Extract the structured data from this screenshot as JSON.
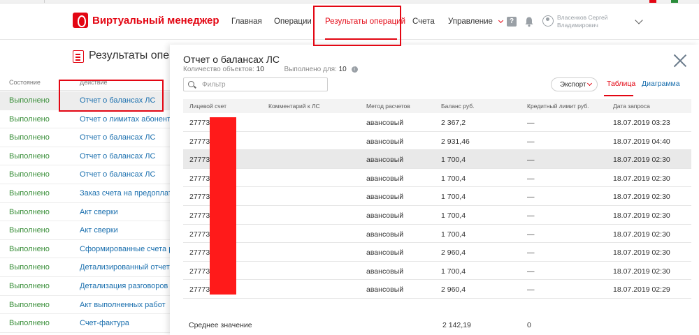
{
  "brand": {
    "name": "Виртуальный менеджер",
    "accent": "#e30613"
  },
  "nav": {
    "items": [
      "Главная",
      "Операции",
      "Результаты операций",
      "Счета",
      "Управление"
    ],
    "active": "Результаты операций",
    "help_label": "?",
    "user_name_line1": "Власенков Сергей",
    "user_name_line2": "Владимирович"
  },
  "left": {
    "title": "Результаты операц",
    "headers": {
      "status": "Состояние",
      "action": "Действие"
    },
    "rows": [
      {
        "status": "Выполнено",
        "action": "Отчет о балансах ЛС"
      },
      {
        "status": "Выполнено",
        "action": "Отчет о лимитах абонентов"
      },
      {
        "status": "Выполнено",
        "action": "Отчет о балансах ЛС"
      },
      {
        "status": "Выполнено",
        "action": "Отчет о балансах ЛС"
      },
      {
        "status": "Выполнено",
        "action": "Отчет о балансах ЛС"
      },
      {
        "status": "Выполнено",
        "action": "Заказ счета на предоплату"
      },
      {
        "status": "Выполнено",
        "action": "Акт сверки"
      },
      {
        "status": "Выполнено",
        "action": "Акт сверки"
      },
      {
        "status": "Выполнено",
        "action": "Сформированные счета расч"
      },
      {
        "status": "Выполнено",
        "action": "Детализированный отчет по"
      },
      {
        "status": "Выполнено",
        "action": "Детализация разговоров"
      },
      {
        "status": "Выполнено",
        "action": "Акт выполненных работ"
      },
      {
        "status": "Выполнено",
        "action": "Счет-фактура"
      }
    ]
  },
  "panel": {
    "title": "Отчет о балансах ЛС",
    "count_label": "Количество объектов:",
    "count_value": "10",
    "done_label": "Выполнено для:",
    "done_value": "10",
    "info_label": "i",
    "filter_placeholder": "Фильтр",
    "export_label": "Экспорт",
    "tabs": [
      "Таблица",
      "Диаграмма"
    ],
    "columns": [
      "Лицевой счет",
      "Комментарий к ЛС",
      "Метод расчетов",
      "Баланс руб.",
      "Кредитный лимит руб.",
      "Дата запроса"
    ],
    "rows": [
      {
        "account": "277738",
        "comment": "",
        "method": "авансовый",
        "balance": "2 367,2",
        "limit": "—",
        "date": "18.07.2019 03:23"
      },
      {
        "account": "277738",
        "comment": "",
        "method": "авансовый",
        "balance": "2 931,46",
        "limit": "—",
        "date": "18.07.2019 04:40"
      },
      {
        "account": "277733",
        "comment": "",
        "method": "авансовый",
        "balance": "1 700,4",
        "limit": "—",
        "date": "18.07.2019 02:30"
      },
      {
        "account": "277733",
        "comment": "",
        "method": "авансовый",
        "balance": "1 700,4",
        "limit": "—",
        "date": "18.07.2019 02:30"
      },
      {
        "account": "277733",
        "comment": "",
        "method": "авансовый",
        "balance": "1 700,4",
        "limit": "—",
        "date": "18.07.2019 02:30"
      },
      {
        "account": "277733",
        "comment": "",
        "method": "авансовый",
        "balance": "1 700,4",
        "limit": "—",
        "date": "18.07.2019 02:30"
      },
      {
        "account": "277733",
        "comment": "",
        "method": "авансовый",
        "balance": "1 700,4",
        "limit": "—",
        "date": "18.07.2019 02:30"
      },
      {
        "account": "277733",
        "comment": "",
        "method": "авансовый",
        "balance": "2 960,4",
        "limit": "—",
        "date": "18.07.2019 02:30"
      },
      {
        "account": "277733",
        "comment": "",
        "method": "авансовый",
        "balance": "1 700,4",
        "limit": "—",
        "date": "18.07.2019 02:30"
      },
      {
        "account": "277733",
        "comment": "",
        "method": "авансовый",
        "balance": "2 960,4",
        "limit": "—",
        "date": "18.07.2019 02:29"
      }
    ],
    "summary": {
      "label": "Среднее значение",
      "balance": "2 142,19",
      "limit": "0"
    }
  }
}
